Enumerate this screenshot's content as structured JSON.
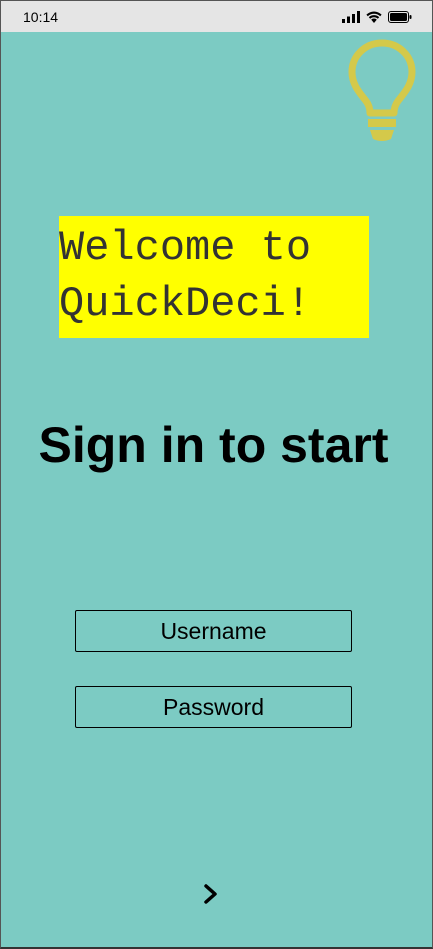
{
  "status_bar": {
    "time": "10:14",
    "icons": [
      "signal-icon",
      "wifi-icon",
      "battery-icon"
    ]
  },
  "logo": {
    "icon": "lightbulb-icon",
    "color": "#d4c94a"
  },
  "welcome": {
    "text": "Welcome to QuickDeci!",
    "highlight_color": "#ffff00"
  },
  "title": "Sign in to start",
  "form": {
    "username_label": "Username",
    "password_label": "Password"
  },
  "next_button": {
    "icon": "chevron-right-icon"
  },
  "colors": {
    "background": "#7ccbc3",
    "status_bar": "#e5e5e5"
  }
}
